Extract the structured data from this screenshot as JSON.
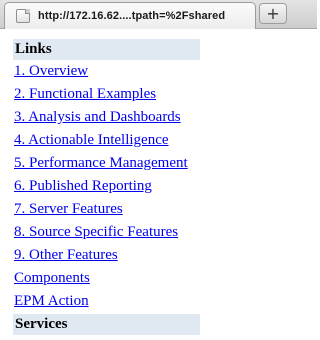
{
  "browser": {
    "tab_title": "http://172.16.62....tpath=%2Fshared",
    "new_tab_glyph": "+",
    "favicon_icon": "page-icon",
    "new_tab_icon": "plus-icon"
  },
  "page": {
    "links_header": "Links",
    "links": [
      "1. Overview",
      "2. Functional Examples",
      "3. Analysis and Dashboards",
      "4. Actionable Intelligence",
      "5. Performance Management",
      "6. Published Reporting",
      "7. Server Features",
      "8. Source Specific Features",
      "9. Other Features",
      "Components",
      "EPM Action"
    ],
    "services_header": "Services"
  },
  "colors": {
    "header_background": "#e0e8f1",
    "link": "#0000ee"
  }
}
